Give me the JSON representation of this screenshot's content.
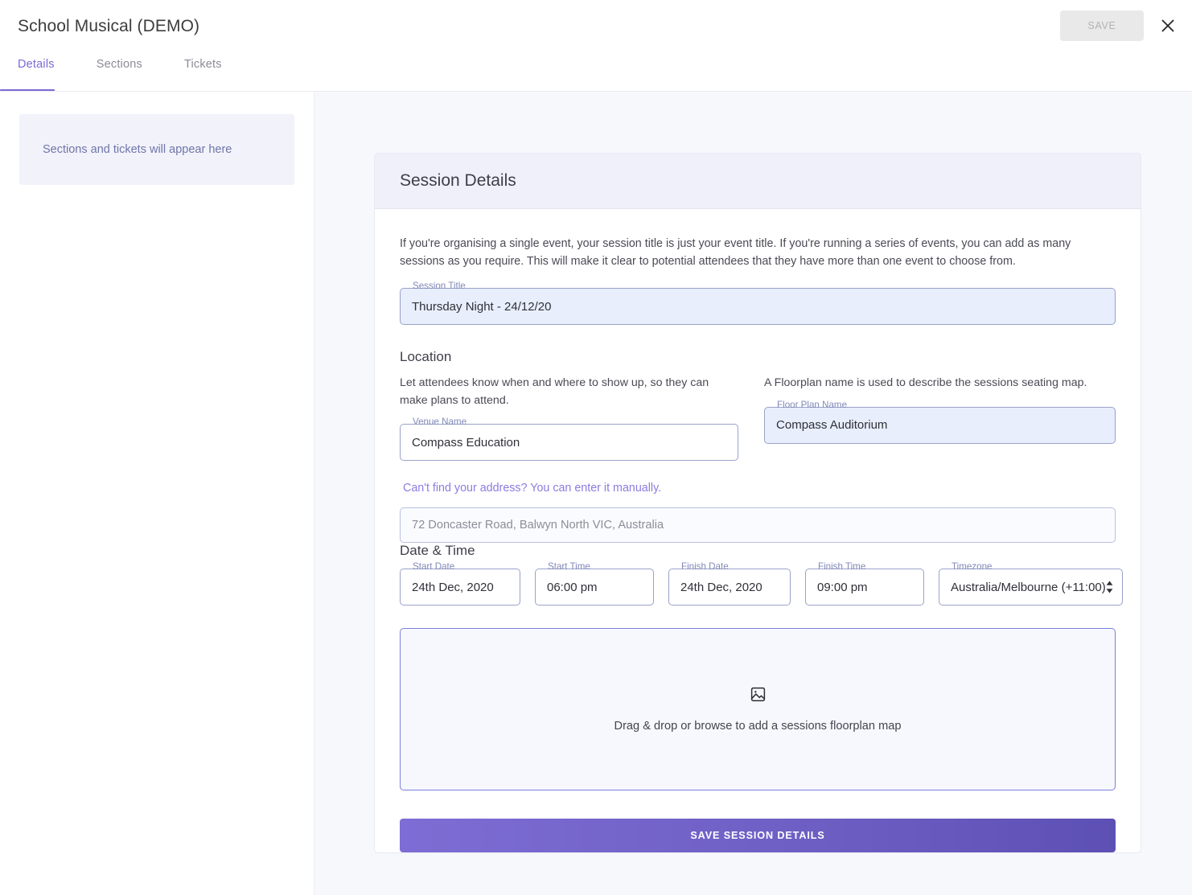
{
  "header": {
    "title": "School Musical (DEMO)",
    "save_label": "SAVE",
    "close_icon": "close-icon"
  },
  "tabs": [
    {
      "label": "Details",
      "active": true
    },
    {
      "label": "Sections",
      "active": false
    },
    {
      "label": "Tickets",
      "active": false
    }
  ],
  "sidebar": {
    "placeholder_text": "Sections and tickets will appear here"
  },
  "card": {
    "title": "Session Details",
    "intro": "If you're organising a single event, your session title is just your event title. If you're running a series of events, you can add as many sessions as you require. This will make it clear to potential attendees that they have more than one event to choose from.",
    "session_title": {
      "label": "Session Title",
      "value": "Thursday Night - 24/12/20"
    },
    "location": {
      "heading": "Location",
      "left_helper": "Let attendees know when and where to show up, so they can make plans to attend.",
      "right_helper": "A Floorplan name is used to describe the sessions seating map.",
      "venue_name": {
        "label": "Venue Name",
        "value": "Compass Education"
      },
      "floor_plan_name": {
        "label": "Floor Plan Name",
        "value": "Compass Auditorium"
      },
      "manual_address_link": "Can't find your address? You can enter it manually.",
      "address_placeholder": "72 Doncaster Road, Balwyn North VIC, Australia"
    },
    "date_time": {
      "heading": "Date & Time",
      "fields": [
        {
          "label": "Start Date",
          "value": "24th Dec, 2020"
        },
        {
          "label": "Start Time",
          "value": "06:00 pm"
        },
        {
          "label": "Finish Date",
          "value": "24th Dec, 2020"
        },
        {
          "label": "Finish Time",
          "value": "09:00 pm"
        }
      ],
      "timezone": {
        "label": "Timezone",
        "value": "Australia/Melbourne (+11:00)"
      }
    },
    "dropzone": {
      "icon": "image-icon",
      "text": "Drag & drop or browse to add a sessions floorplan map"
    },
    "save_button_label": "SAVE SESSION DETAILS"
  },
  "colors": {
    "accent": "#7b6ad6",
    "link": "#8c7ce0",
    "autofill": "#e8eefb",
    "panel_bg": "#f7f8fc",
    "card_header_bg": "#eff0fa"
  }
}
